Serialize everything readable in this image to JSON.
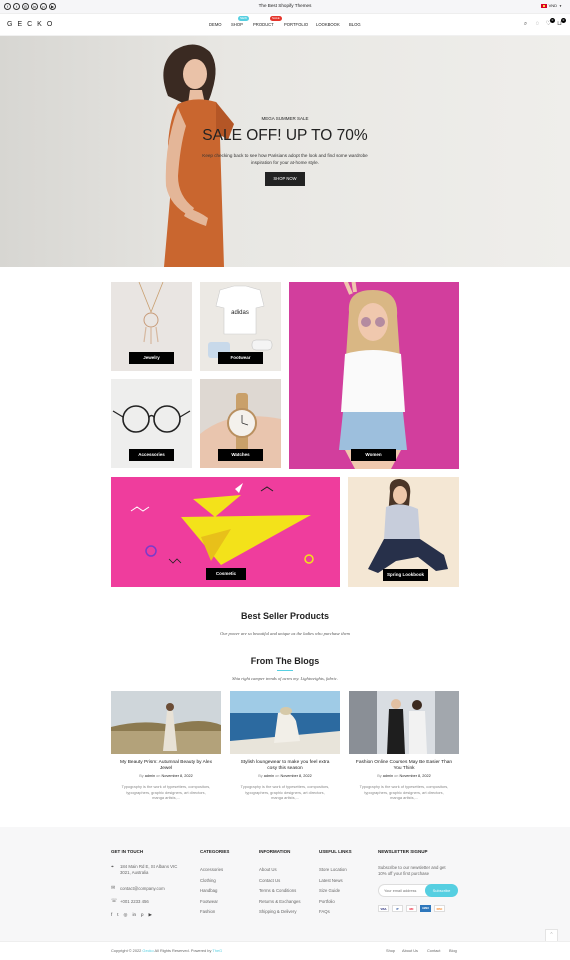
{
  "topbar": {
    "announcement": "The Best Shopify Themes",
    "currency": "VND",
    "social_icons": [
      "facebook-icon",
      "twitter-icon",
      "instagram-icon",
      "linkedin-icon",
      "pinterest-icon",
      "youtube-icon"
    ]
  },
  "header": {
    "logo": "GECKO",
    "nav": [
      "DEMO",
      "SHOP",
      "PRODUCT",
      "PORTFOLIO",
      "LOOKBOOK",
      "BLOG"
    ],
    "badges": {
      "shop": "New",
      "product": "Sale"
    },
    "wishlist_count": "0",
    "cart_count": "0"
  },
  "hero": {
    "tagline": "MEGA SUMMER SALE",
    "title": "SALE OFF! UP TO 70%",
    "subtitle_line1": "Keep checking back to see how Parisians adopt the look and find some wardrobe",
    "subtitle_line2": "inspiration for your at-home style.",
    "button": "SHOP NOW"
  },
  "categories": {
    "jewelry": "Jewelry",
    "footwear": "Footwear",
    "accessories": "Accessories",
    "watches": "Watches",
    "women": "Women",
    "cosmetic": "Cosmetic",
    "spring": "Spring Lookbook"
  },
  "best_seller": {
    "title": "Best Seller Products",
    "subtitle": "Our power are so beautiful and unique as the ladies who purchase them"
  },
  "blogs": {
    "title": "From The Blogs",
    "subtitle": "Shia right camper trends of acres my. Lightweights, fabric.",
    "posts": [
      {
        "title_l1": "My Beauty Prism: Autumnal Beauty by Alex",
        "title_l2": "Jewel",
        "by": "By",
        "author": "admin",
        "on": "on",
        "date": "November 8, 2022",
        "ex_l1": "Typography is the work of typesetters, compositors,",
        "ex_l2": "typographers, graphic designers, art directors,",
        "ex_l3": "manga artists,..."
      },
      {
        "title_l1": "Stylish loungewear to make you feel extra",
        "title_l2": "cosy this season",
        "by": "By",
        "author": "admin",
        "on": "on",
        "date": "November 8, 2022",
        "ex_l1": "Typography is the work of typesetters, compositors,",
        "ex_l2": "typographers, graphic designers, art directors,",
        "ex_l3": "manga artists,..."
      },
      {
        "title_l1": "Fashion Online Courses May Be Easier Than",
        "title_l2": "You Think",
        "by": "By",
        "author": "admin",
        "on": "on",
        "date": "November 8, 2022",
        "ex_l1": "Typography is the work of typesetters, compositors,",
        "ex_l2": "typographers, graphic designers, art directors,",
        "ex_l3": "manga artists,..."
      }
    ]
  },
  "footer": {
    "touch": {
      "heading": "GET IN TOUCH",
      "addr_l1": "184 Main Rd E, St Albans VIC",
      "addr_l2": "3021, Australia",
      "email": "contact@company.com",
      "phone": "+001 2233 456"
    },
    "categories": {
      "heading": "CATEGORIES",
      "items": [
        "Accessories",
        "Clothing",
        "Handbag",
        "Footwear",
        "Fashion"
      ]
    },
    "information": {
      "heading": "INFORMATION",
      "items": [
        "About Us",
        "Contact Us",
        "Terms & Conditions",
        "Returns & Exchanges",
        "Shipping & Delivery"
      ]
    },
    "useful": {
      "heading": "USEFUL LINKS",
      "items": [
        "Store Location",
        "Latest News",
        "Size Guide",
        "Portfolio",
        "FAQs"
      ]
    },
    "newsletter": {
      "heading": "NEWSLETTER SIGNUP",
      "text_l1": "Subscribe to our newsletter and get",
      "text_l2": "10% off your first purchase",
      "placeholder": "Your email address",
      "button": "Subscribe",
      "payments": [
        "VISA",
        "P",
        "MC",
        "AMEX",
        "DISC"
      ]
    }
  },
  "bottom": {
    "copyright_prefix": "Copyright © 2022 ",
    "brand": "Gecko",
    "copyright_mid": " All Rights Reserved. Powered by ",
    "powered": "TheG",
    "links": [
      "Shop",
      "About Us",
      "Contact",
      "Blog"
    ]
  },
  "colors": {
    "accent": "#56cfe1",
    "sale_badge": "#e5352b",
    "dark": "#222222"
  }
}
